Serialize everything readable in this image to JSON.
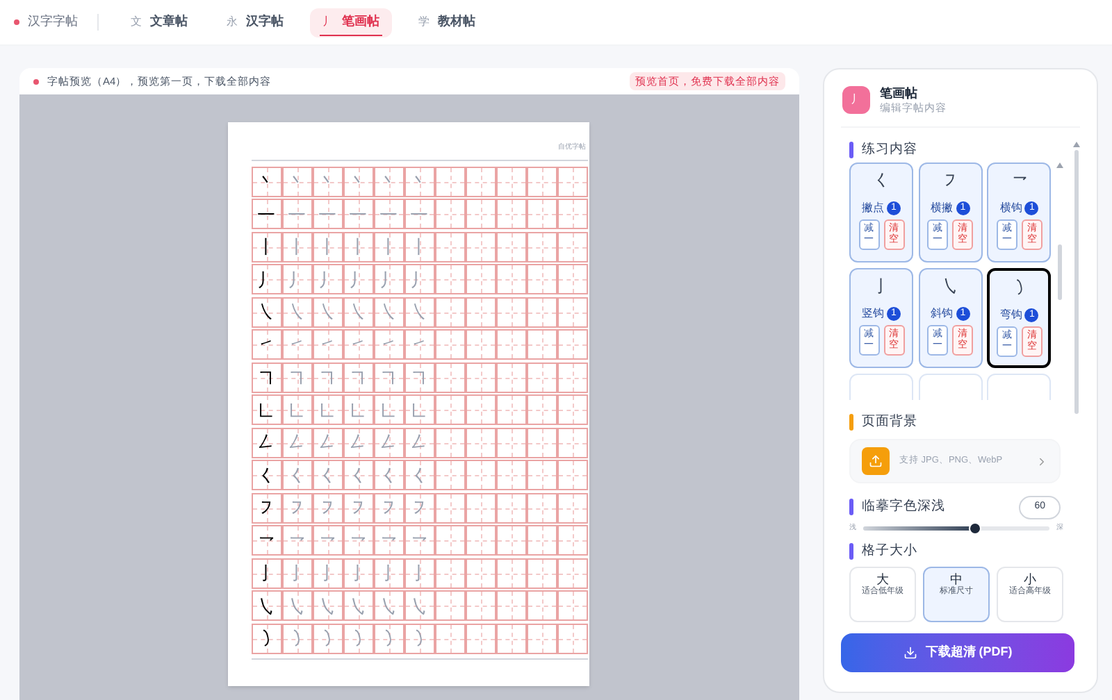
{
  "nav": {
    "brand": "汉字字帖",
    "tabs": [
      {
        "icon": "文",
        "label": "文章帖",
        "selected": false
      },
      {
        "icon": "永",
        "label": "汉字帖",
        "selected": false
      },
      {
        "icon": "丿",
        "label": "笔画帖",
        "selected": true
      },
      {
        "icon": "学",
        "label": "教材帖",
        "selected": false
      }
    ]
  },
  "preview": {
    "notice": "字帖预览（A4），预览第一页，下载全部内容",
    "badge": "预览首页，免费下载全部内容",
    "sheet": {
      "header": "自优字帖",
      "rows": [
        {
          "cells": [
            "丶",
            "丶",
            "丶",
            "丶",
            "丶",
            "丶"
          ]
        },
        {
          "cells": [
            "一",
            "一",
            "一",
            "一",
            "一",
            "一"
          ]
        },
        {
          "cells": [
            "丨",
            "丨",
            "丨",
            "丨",
            "丨",
            "丨"
          ]
        },
        {
          "cells": [
            "丿",
            "丿",
            "丿",
            "丿",
            "丿",
            "丿"
          ]
        },
        {
          "cells": [
            "㇏",
            "㇏",
            "㇏",
            "㇏",
            "㇏",
            "㇏"
          ]
        },
        {
          "cells": [
            "㇀",
            "㇀",
            "㇀",
            "㇀",
            "㇀",
            "㇀"
          ]
        },
        {
          "cells": [
            "㇕",
            "㇕",
            "㇕",
            "㇕",
            "㇕",
            "㇕"
          ]
        },
        {
          "cells": [
            "㇗",
            "㇗",
            "㇗",
            "㇗",
            "㇗",
            "㇗"
          ]
        },
        {
          "cells": [
            "㇜",
            "㇜",
            "㇜",
            "㇜",
            "㇜",
            "㇜"
          ]
        },
        {
          "cells": [
            "㇛",
            "㇛",
            "㇛",
            "㇛",
            "㇛",
            "㇛"
          ]
        },
        {
          "cells": [
            "㇇",
            "㇇",
            "㇇",
            "㇇",
            "㇇",
            "㇇"
          ]
        },
        {
          "cells": [
            "㇖",
            "㇖",
            "㇖",
            "㇖",
            "㇖",
            "㇖"
          ]
        },
        {
          "cells": [
            "㇚",
            "㇚",
            "㇚",
            "㇚",
            "㇚",
            "㇚"
          ]
        },
        {
          "cells": [
            "㇂",
            "㇂",
            "㇂",
            "㇂",
            "㇂",
            "㇂"
          ]
        },
        {
          "cells": [
            "㇁",
            "㇁",
            "㇁",
            "㇁",
            "㇁",
            "㇁"
          ]
        }
      ]
    }
  },
  "editor": {
    "icon": "丿",
    "title": "笔画帖",
    "subtitle": "编辑字帖内容",
    "practice": {
      "title": "练习内容",
      "strokes": [
        {
          "glyph": "㇛",
          "name": "撇点",
          "count": "1",
          "minus": "减一",
          "clear": "清空",
          "selected": false
        },
        {
          "glyph": "㇇",
          "name": "横撇",
          "count": "1",
          "minus": "减一",
          "clear": "清空",
          "selected": false
        },
        {
          "glyph": "㇖",
          "name": "横钩",
          "count": "1",
          "minus": "减一",
          "clear": "清空",
          "selected": false
        },
        {
          "glyph": "㇚",
          "name": "竖钩",
          "count": "1",
          "minus": "减一",
          "clear": "清空",
          "selected": false
        },
        {
          "glyph": "㇂",
          "name": "斜钩",
          "count": "1",
          "minus": "减一",
          "clear": "清空",
          "selected": false
        },
        {
          "glyph": "㇁",
          "name": "弯钩",
          "count": "1",
          "minus": "减一",
          "clear": "清空",
          "selected": true
        }
      ]
    },
    "background": {
      "title": "页面背景",
      "hint": "支持 JPG、PNG、WebP"
    },
    "shade": {
      "title": "临摹字色深浅",
      "value": "60",
      "light": "浅",
      "dark": "深",
      "level": 0.6
    },
    "grid_size": {
      "title": "格子大小",
      "options": [
        {
          "size": "大",
          "note": "适合低年级",
          "selected": false
        },
        {
          "size": "中",
          "note": "标准尺寸",
          "selected": true
        },
        {
          "size": "小",
          "note": "适合高年级",
          "selected": false
        }
      ]
    },
    "download": {
      "label": "下载超清 (PDF)"
    }
  }
}
